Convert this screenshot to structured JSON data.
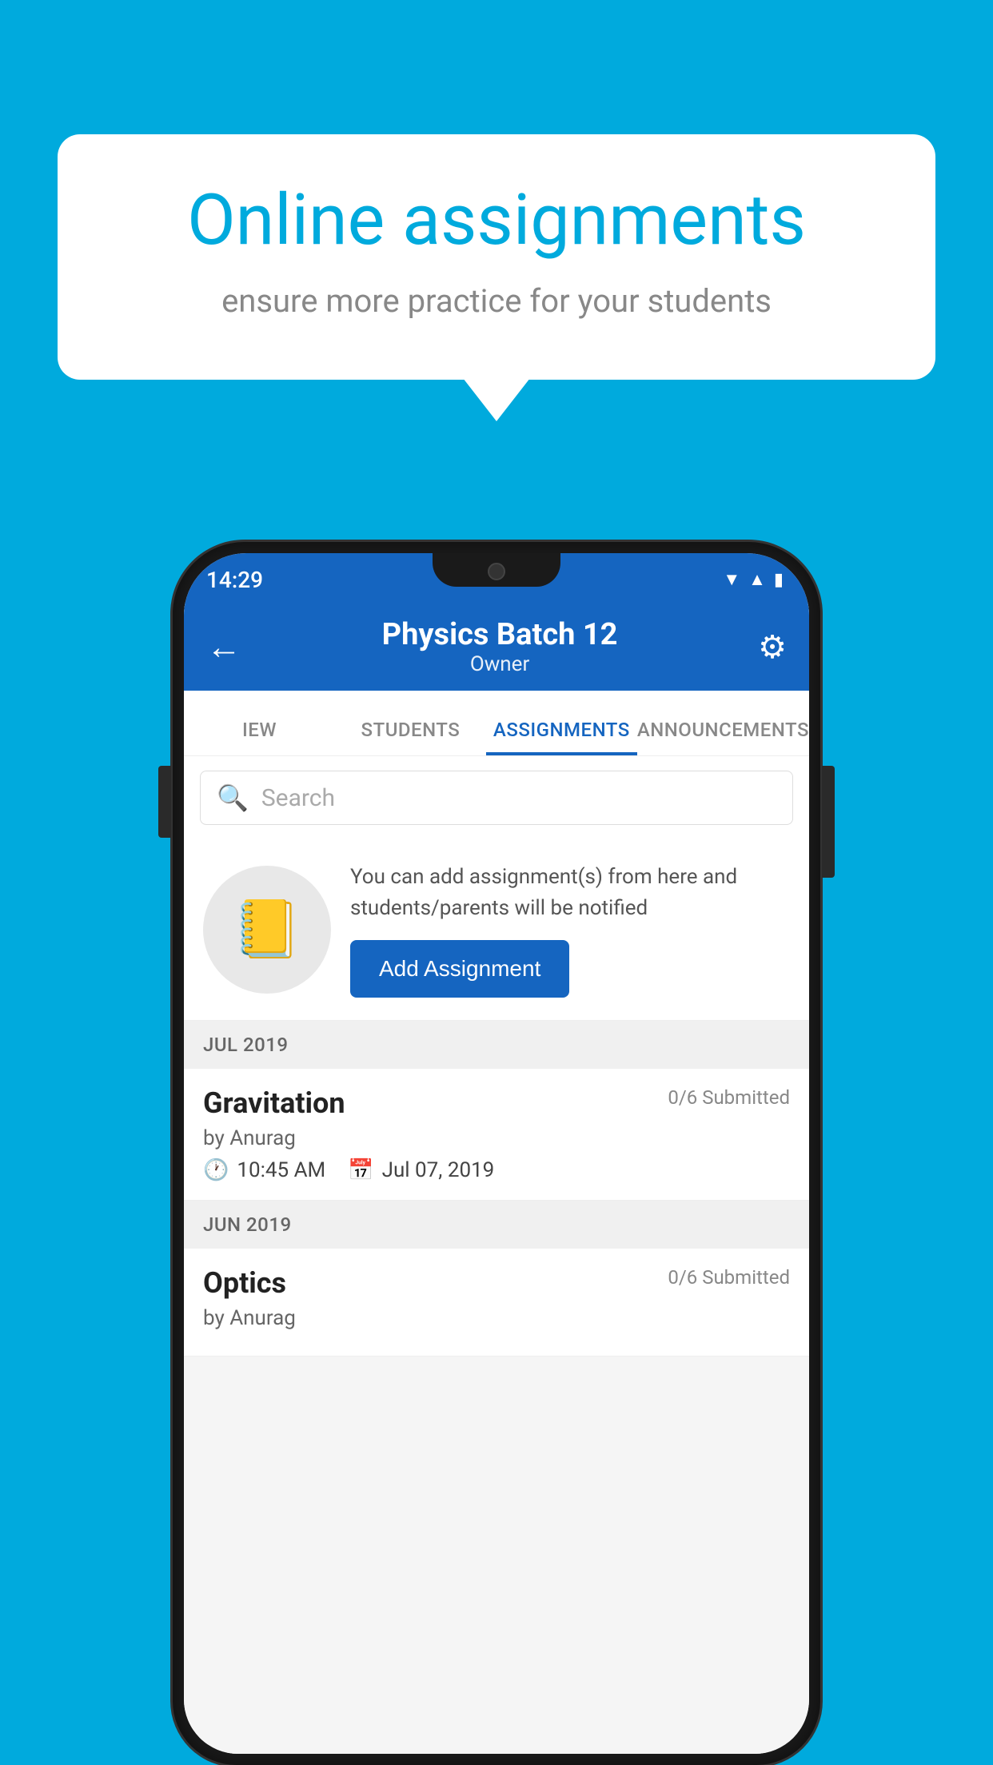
{
  "background_color": "#00AADD",
  "speech_bubble": {
    "title": "Online assignments",
    "subtitle": "ensure more practice for your students"
  },
  "status_bar": {
    "time": "14:29",
    "icons": [
      "wifi",
      "signal",
      "battery"
    ]
  },
  "header": {
    "title": "Physics Batch 12",
    "subtitle": "Owner",
    "back_label": "←",
    "settings_label": "⚙"
  },
  "tabs": [
    {
      "label": "IEW",
      "active": false
    },
    {
      "label": "STUDENTS",
      "active": false
    },
    {
      "label": "ASSIGNMENTS",
      "active": true
    },
    {
      "label": "ANNOUNCEMENTS",
      "active": false
    }
  ],
  "search": {
    "placeholder": "Search"
  },
  "assignment_promo": {
    "description": "You can add assignment(s) from here and students/parents will be notified",
    "button_label": "Add Assignment"
  },
  "month_sections": [
    {
      "month": "JUL 2019",
      "assignments": [
        {
          "name": "Gravitation",
          "submitted": "0/6 Submitted",
          "author": "by Anurag",
          "time": "10:45 AM",
          "date": "Jul 07, 2019"
        }
      ]
    },
    {
      "month": "JUN 2019",
      "assignments": [
        {
          "name": "Optics",
          "submitted": "0/6 Submitted",
          "author": "by Anurag",
          "time": "",
          "date": ""
        }
      ]
    }
  ]
}
